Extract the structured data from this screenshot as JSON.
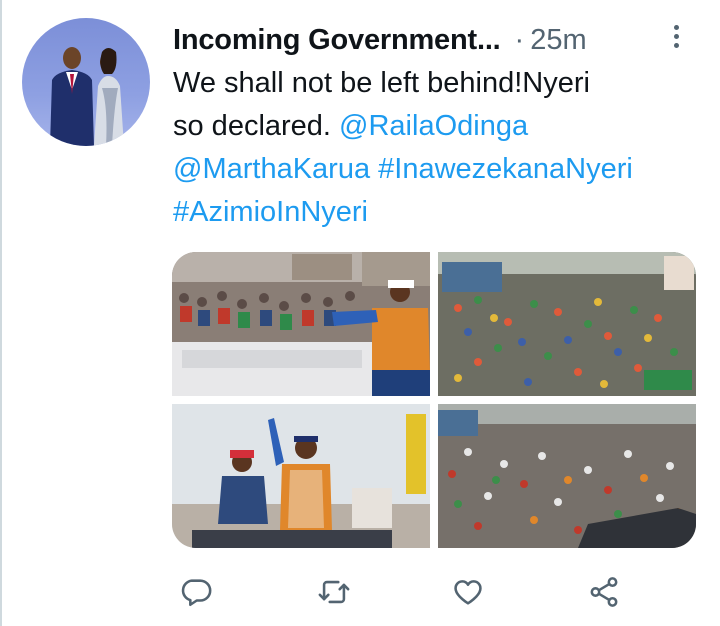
{
  "tweet": {
    "author_name": "Incoming Government...",
    "separator": "·",
    "time": "25m",
    "text_lines": [
      {
        "plain": "We shall not be left behind!Nyeri",
        "link": ""
      },
      {
        "plain": "so declared. ",
        "link": "@RailaOdinga"
      },
      {
        "plain": "",
        "link": "@MarthaKarua #InawezekanaNyeri"
      },
      {
        "plain": "",
        "link": "#AzimioInNyeri"
      }
    ]
  },
  "icons": {
    "more": "more-vertical-icon",
    "reply": "reply-bubble-icon",
    "retweet": "retweet-icon",
    "like": "heart-icon",
    "share": "share-icon"
  },
  "colors": {
    "link": "#1d9bf0",
    "text": "#0f1419",
    "secondary": "#536471",
    "icon": "#536471"
  }
}
